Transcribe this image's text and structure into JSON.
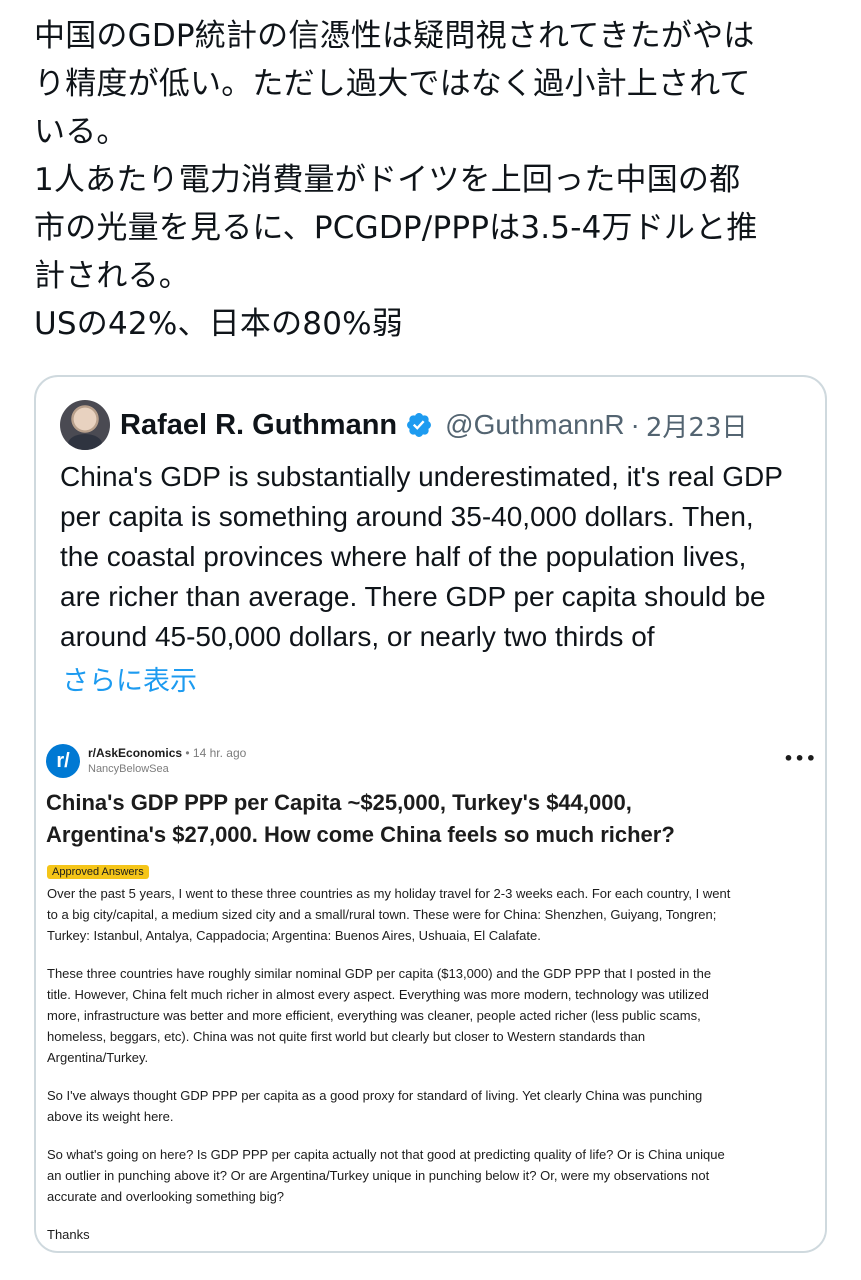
{
  "tweet": {
    "lines": [
      "中国のGDP統計の信憑性は疑問視されてきたがやは",
      "り精度が低い。ただし過大ではなく過小計上されて",
      "いる。",
      "1人あたり電力消費量がドイツを上回った中国の都",
      "市の光量を見るに、PCGDP/PPPは3.5-4万ドルと推",
      "計される。",
      "USの42%、日本の80%弱"
    ]
  },
  "quote": {
    "name": "Rafael R. Guthmann",
    "handle": "@GuthmannR",
    "separator": "·",
    "date": "2月23日",
    "lines": [
      "China's GDP is substantially underestimated, it's real GDP",
      "per capita is something around 35-40,000 dollars. Then,",
      "the coastal provinces where half of the population lives,",
      "are richer than average. There GDP per capita should be",
      "around 45-50,000 dollars, or nearly two thirds of"
    ],
    "show_more": "さらに表示"
  },
  "reddit": {
    "logo": "r/",
    "subreddit": "r/AskEconomics",
    "time": "• 14 hr. ago",
    "user": "NancyBelowSea",
    "more": "•••",
    "title_lines": [
      "China's GDP PPP per Capita ~$25,000, Turkey's $44,000,",
      "Argentina's $27,000. How come China feels so much richer?"
    ],
    "badge": "Approved Answers",
    "paragraphs": [
      [
        "Over the past 5 years, I went to these three countries as my holiday travel for 2-3 weeks each. For each country, I went",
        "to a big city/capital, a medium sized city and a small/rural town. These were for China: Shenzhen, Guiyang, Tongren;",
        "Turkey: Istanbul, Antalya, Cappadocia; Argentina: Buenos Aires, Ushuaia, El Calafate."
      ],
      [
        "These three countries have roughly similar nominal GDP per capita ($13,000) and the GDP PPP that I posted in the",
        "title. However, China felt much richer in almost every aspect. Everything was more modern, technology was utilized",
        "more, infrastructure was better and more efficient, everything was cleaner, people acted richer (less public scams,",
        "homeless, beggars, etc). China was not quite first world but clearly but closer to Western standards than",
        "Argentina/Turkey."
      ],
      [
        "So I've always thought GDP PPP per capita as a good proxy for standard of living. Yet clearly China was punching",
        "above its weight here."
      ],
      [
        "So what's going on here? Is GDP PPP per capita actually not that good at predicting quality of life? Or is China unique",
        "an outlier in punching above it? Or are Argentina/Turkey unique in punching below it? Or, were my observations not",
        "accurate and overlooking something big?"
      ],
      [
        "Thanks"
      ]
    ]
  },
  "colors": {
    "link": "#1d9bf0",
    "reddit_blue": "#0079d3",
    "badge": "#f5c518",
    "verified": "#1d9bf0"
  },
  "icons": {
    "verified": "verified-badge-icon",
    "avatar": "user-avatar",
    "reddit_logo": "reddit-logo-icon",
    "more": "more-options-icon"
  }
}
